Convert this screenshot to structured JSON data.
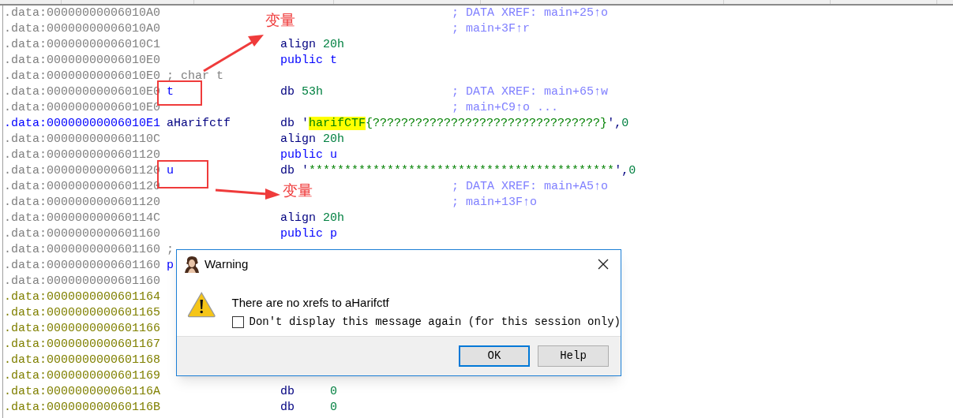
{
  "listing": [
    {
      "address": ".data:00000000006010A0",
      "kind": "plain",
      "comment": "; DATA XREF: main+25↑o"
    },
    {
      "address": ".data:00000000006010A0",
      "kind": "plain",
      "comment": "; main+3F↑r"
    },
    {
      "address": ".data:00000000006010C1",
      "kind": "plain",
      "mnemonic": {
        "text": "align",
        "kind": "directive"
      },
      "operand": [
        {
          "text": "20h",
          "kind": "number"
        }
      ]
    },
    {
      "address": ".data:00000000006010E0",
      "kind": "plain",
      "mnemonic": {
        "text": "public",
        "kind": "public"
      },
      "operand": [
        {
          "text": "t",
          "kind": "symbol"
        }
      ]
    },
    {
      "address": ".data:00000000006010E0",
      "kind": "plain",
      "label": {
        "text": "; char t",
        "kind": "comment"
      }
    },
    {
      "address": ".data:00000000006010E0",
      "kind": "plain",
      "label": {
        "text": "t",
        "kind": "name"
      },
      "mnemonic": {
        "text": "db",
        "kind": "directive"
      },
      "operand": [
        {
          "text": "53h",
          "kind": "number"
        }
      ],
      "comment": "; DATA XREF: main+65↑w"
    },
    {
      "address": ".data:00000000006010E0",
      "kind": "plain",
      "comment": "; main+C9↑o ..."
    },
    {
      "address": ".data:00000000006010E1",
      "kind": "current",
      "label": {
        "text": "aHarifctf",
        "kind": "string_name"
      },
      "mnemonic": {
        "text": "db",
        "kind": "directive"
      },
      "operand": [
        {
          "text": "'",
          "kind": "punct"
        },
        {
          "text": "harifCTF",
          "kind": "highlight"
        },
        {
          "text": "{????????????????????????????????}",
          "kind": "string"
        },
        {
          "text": "',",
          "kind": "punct"
        },
        {
          "text": "0",
          "kind": "number"
        }
      ]
    },
    {
      "address": ".data:000000000060110C",
      "kind": "plain",
      "mnemonic": {
        "text": "align",
        "kind": "directive"
      },
      "operand": [
        {
          "text": "20h",
          "kind": "number"
        }
      ]
    },
    {
      "address": ".data:0000000000601120",
      "kind": "plain",
      "mnemonic": {
        "text": "public",
        "kind": "public"
      },
      "operand": [
        {
          "text": "u",
          "kind": "symbol"
        }
      ]
    },
    {
      "address": ".data:0000000000601120",
      "kind": "plain",
      "label": {
        "text": "u",
        "kind": "name"
      },
      "mnemonic": {
        "text": "db",
        "kind": "directive"
      },
      "operand": [
        {
          "text": "'",
          "kind": "punct"
        },
        {
          "text": "*******************************************",
          "kind": "string"
        },
        {
          "text": "',",
          "kind": "punct"
        },
        {
          "text": "0",
          "kind": "number"
        }
      ]
    },
    {
      "address": ".data:0000000000601120",
      "kind": "plain",
      "comment": "; DATA XREF: main+A5↑o"
    },
    {
      "address": ".data:0000000000601120",
      "kind": "plain",
      "comment": "; main+13F↑o"
    },
    {
      "address": ".data:000000000060114C",
      "kind": "plain",
      "mnemonic": {
        "text": "align",
        "kind": "directive"
      },
      "operand": [
        {
          "text": "20h",
          "kind": "number"
        }
      ]
    },
    {
      "address": ".data:0000000000601160",
      "kind": "plain",
      "mnemonic": {
        "text": "public",
        "kind": "public"
      },
      "operand": [
        {
          "text": "p",
          "kind": "symbol"
        }
      ]
    },
    {
      "address": ".data:0000000000601160",
      "kind": "plain",
      "label": {
        "text": ";",
        "kind": "comment"
      }
    },
    {
      "address": ".data:0000000000601160",
      "kind": "plain",
      "label": {
        "text": "p",
        "kind": "name"
      }
    },
    {
      "address": ".data:0000000000601160",
      "kind": "plain"
    },
    {
      "address": ".data:0000000000601164",
      "kind": "unexplored"
    },
    {
      "address": ".data:0000000000601165",
      "kind": "unexplored"
    },
    {
      "address": ".data:0000000000601166",
      "kind": "unexplored"
    },
    {
      "address": ".data:0000000000601167",
      "kind": "unexplored"
    },
    {
      "address": ".data:0000000000601168",
      "kind": "unexplored"
    },
    {
      "address": ".data:0000000000601169",
      "kind": "unexplored"
    },
    {
      "address": ".data:000000000060116A",
      "kind": "unexplored",
      "mnemonic": {
        "text": "db",
        "kind": "byte"
      },
      "operand": [
        {
          "text": "0",
          "kind": "number"
        }
      ]
    },
    {
      "address": ".data:000000000060116B",
      "kind": "unexplored",
      "mnemonic": {
        "text": "db",
        "kind": "byte"
      },
      "operand": [
        {
          "text": "0",
          "kind": "number"
        }
      ]
    }
  ],
  "annotations": [
    {
      "kind": "box"
    },
    {
      "kind": "box"
    },
    {
      "kind": "arrow"
    },
    {
      "kind": "arrow"
    },
    {
      "kind": "note",
      "text": "变量"
    },
    {
      "kind": "note",
      "text": "变量"
    }
  ],
  "dialog": {
    "title": "Warning",
    "message": "There are no xrefs to aHarifctf",
    "checkbox": {
      "label": "Don't display this message again (for this session only)",
      "checked": false
    },
    "buttons": [
      {
        "label": "OK",
        "default": true
      },
      {
        "label": "Help",
        "default": false
      }
    ]
  }
}
